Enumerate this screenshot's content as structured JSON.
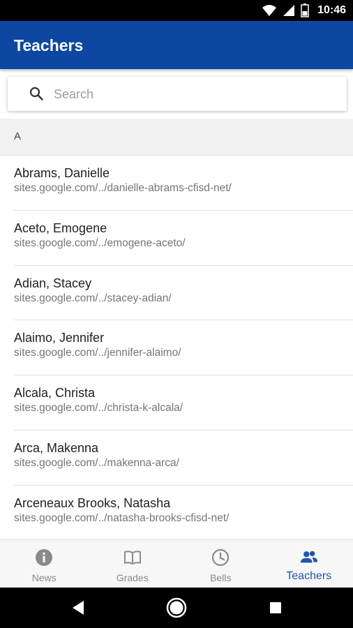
{
  "status_bar": {
    "time": "10:46",
    "icons": [
      "wifi-icon",
      "signal-icon",
      "battery-icon"
    ]
  },
  "app_bar": {
    "title": "Teachers",
    "color": "#0D47A1"
  },
  "search": {
    "placeholder": "Search",
    "value": ""
  },
  "section": {
    "letter": "A"
  },
  "teachers": [
    {
      "name": "Abrams, Danielle",
      "site": "sites.google.com/../danielle-abrams-cfisd-net/"
    },
    {
      "name": "Aceto, Emogene",
      "site": "sites.google.com/../emogene-aceto/"
    },
    {
      "name": "Adian, Stacey",
      "site": "sites.google.com/../stacey-adian/"
    },
    {
      "name": "Alaimo, Jennifer",
      "site": "sites.google.com/../jennifer-alaimo/"
    },
    {
      "name": "Alcala, Christa",
      "site": "sites.google.com/../christa-k-alcala/"
    },
    {
      "name": "Arca, Makenna",
      "site": "sites.google.com/../makenna-arca/"
    },
    {
      "name": "Arceneaux Brooks, Natasha",
      "site": "sites.google.com/../natasha-brooks-cfisd-net/"
    }
  ],
  "bottom_nav": {
    "items": [
      {
        "label": "News",
        "icon": "info-icon",
        "active": false
      },
      {
        "label": "Grades",
        "icon": "book-icon",
        "active": false
      },
      {
        "label": "Bells",
        "icon": "clock-icon",
        "active": false
      },
      {
        "label": "Teachers",
        "icon": "people-icon",
        "active": true
      }
    ],
    "active_color": "#1E56A8"
  },
  "system_nav": {
    "icons": [
      "back-icon",
      "home-icon",
      "recents-icon"
    ]
  }
}
